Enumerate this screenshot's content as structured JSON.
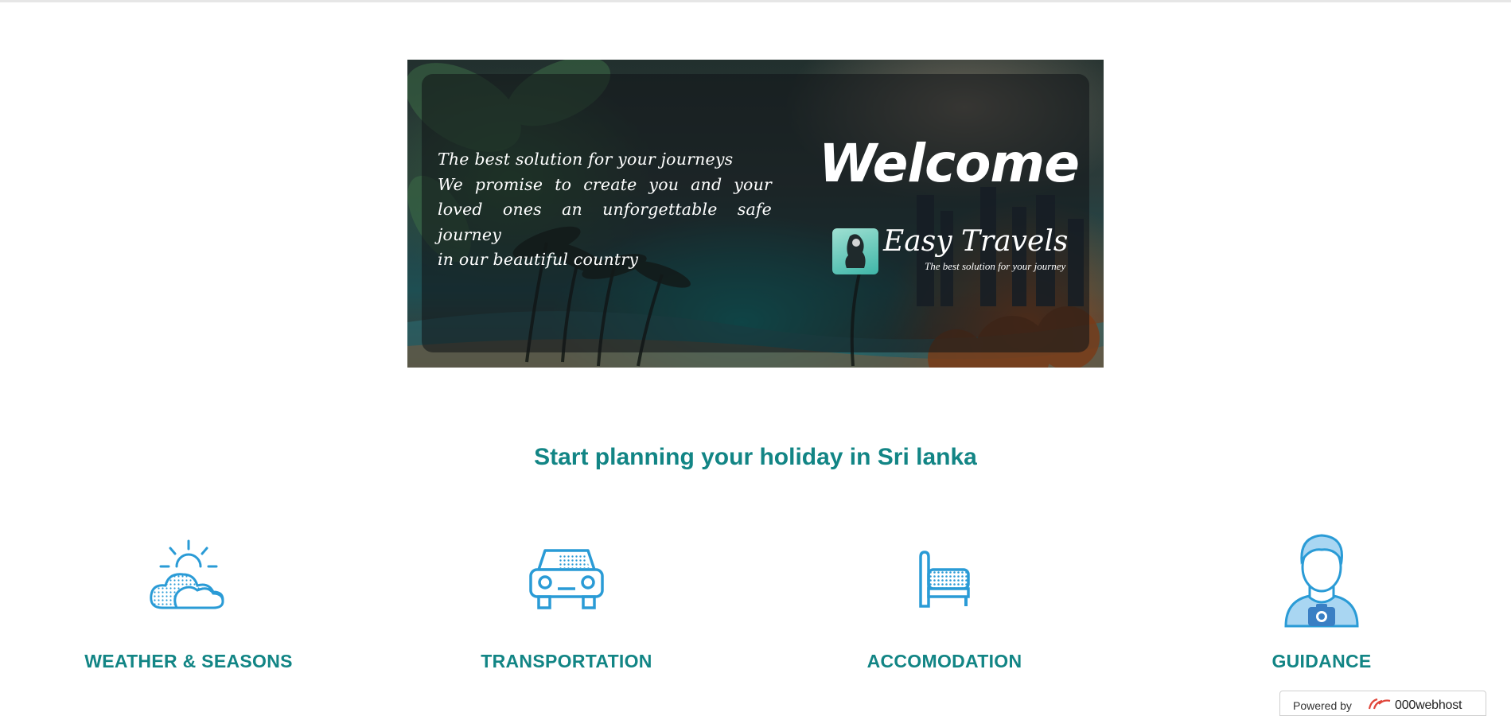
{
  "banner": {
    "tagline": [
      "The best solution for your journeys",
      "We promise to create you and your",
      "loved ones an unforgettable safe journey",
      "in our beautiful country"
    ],
    "welcome": "Welcome",
    "brand_name": "Easy Travels",
    "brand_tagline": "The best solution for your journey"
  },
  "section": {
    "heading": "Start planning your holiday in Sri lanka"
  },
  "features": [
    {
      "label": "WEATHER & SEASONS",
      "icon": "weather-cloud-sun-icon"
    },
    {
      "label": "TRANSPORTATION",
      "icon": "car-icon"
    },
    {
      "label": "ACCOMODATION",
      "icon": "bed-icon"
    },
    {
      "label": "GUIDANCE",
      "icon": "guide-person-camera-icon"
    }
  ],
  "footer_badge": {
    "prefix": "Powered by",
    "host": "000webhost"
  },
  "colors": {
    "accent": "#128585",
    "icon_blue": "#2a9bd6"
  }
}
